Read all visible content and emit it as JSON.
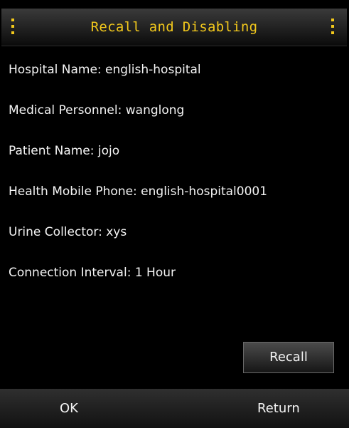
{
  "header": {
    "title": "Recall and Disabling",
    "left_menu_icon": "vertical-dots-icon",
    "right_menu_icon": "vertical-dots-icon"
  },
  "details": [
    {
      "label": "Hospital Name",
      "value": "english-hospital",
      "text": "Hospital Name: english-hospital"
    },
    {
      "label": "Medical Personnel",
      "value": "wanglong",
      "text": "Medical Personnel: wanglong"
    },
    {
      "label": "Patient Name",
      "value": "jojo",
      "text": "Patient Name: jojo"
    },
    {
      "label": "Health Mobile Phone",
      "value": "english-hospital0001",
      "text": "Health Mobile Phone: english-hospital0001"
    },
    {
      "label": "Urine Collector",
      "value": "xys",
      "text": "Urine Collector: xys"
    },
    {
      "label": "Connection Interval",
      "value": "1 Hour",
      "text": "Connection Interval: 1 Hour"
    }
  ],
  "actions": {
    "recall_label": "Recall"
  },
  "softkeys": {
    "left_label": "OK",
    "right_label": "Return"
  },
  "colors": {
    "background": "#000000",
    "title_accent": "#f2c81c",
    "text": "#f4f4f4"
  }
}
